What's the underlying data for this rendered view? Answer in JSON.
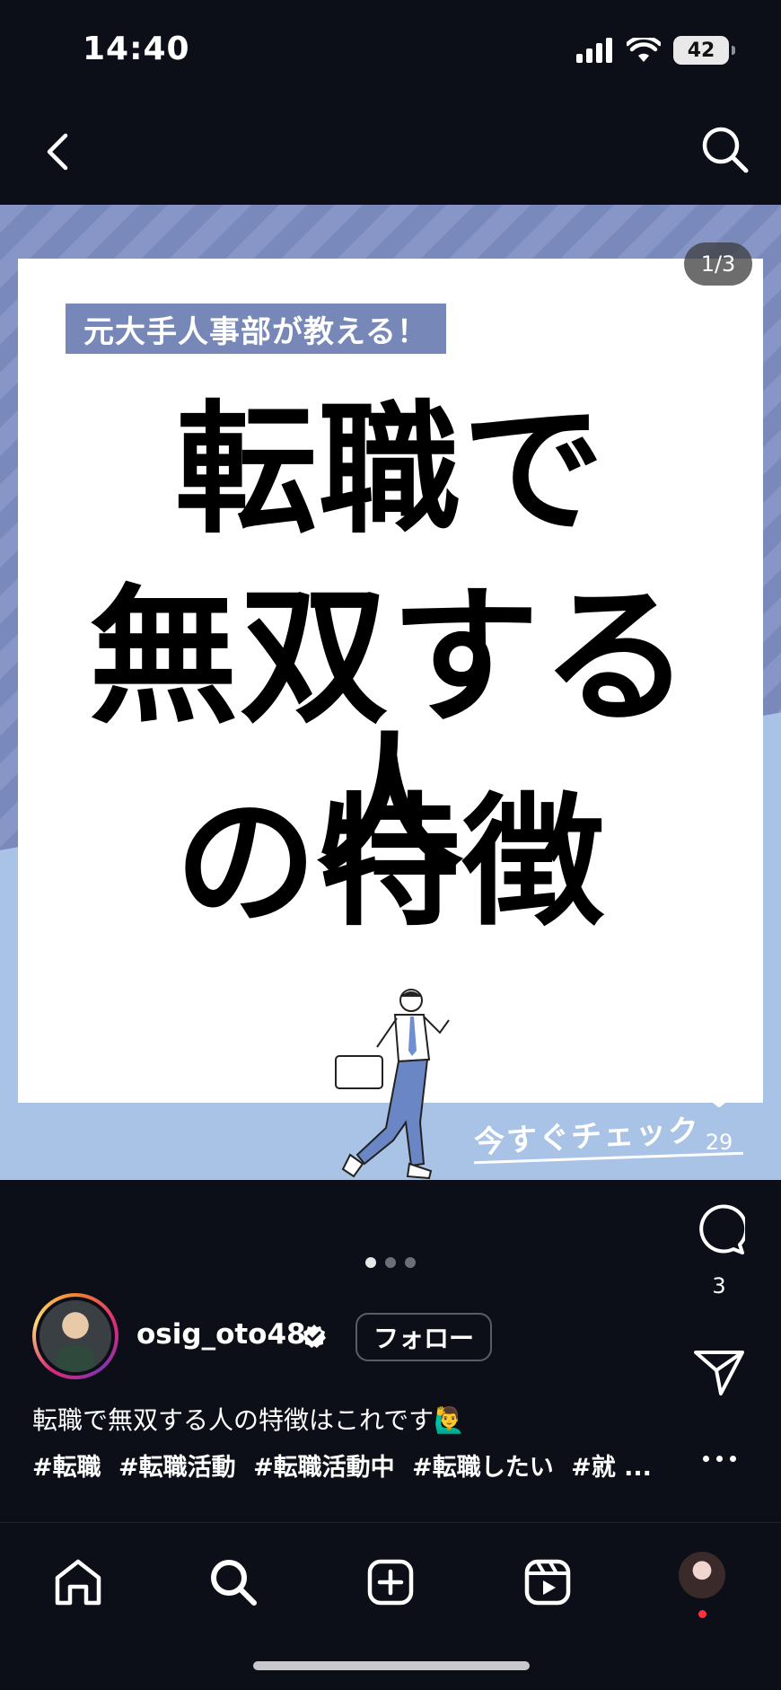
{
  "status_bar": {
    "time": "14:40",
    "battery": "42"
  },
  "post": {
    "counter": "1/3",
    "tagline": "元大手人事部が教える！",
    "headline_line1": "転職で",
    "headline_line2": "無双する人",
    "headline_line3": "の特徴",
    "cta": "今すぐチェック"
  },
  "actions": {
    "like_count": "29",
    "comment_count": "3"
  },
  "author": {
    "username": "osig_oto48",
    "follow_label": "フォロー"
  },
  "caption": {
    "text": "転職で無双する人の特徴はこれです🙋‍♂️",
    "hashtags": [
      "#転職",
      "#転職活動",
      "#転職活動中",
      "#転職したい",
      "#就 ..."
    ]
  },
  "carousel": {
    "total": 3,
    "active": 0
  },
  "bottom_nav": [
    "home-icon",
    "search-icon",
    "create-icon",
    "reels-icon",
    "profile-avatar"
  ],
  "colors": {
    "background": "#0c0f17",
    "tagline_bg": "#7788b8",
    "notification": "#ff3040"
  }
}
